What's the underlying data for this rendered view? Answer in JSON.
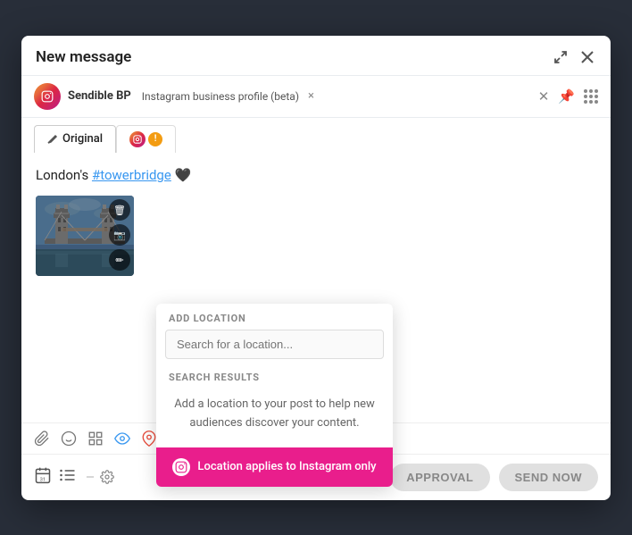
{
  "modal": {
    "title": "New message",
    "expand_icon": "expand",
    "close_icon": "close"
  },
  "profile_bar": {
    "name": "Sendible BP",
    "type": "Instagram business profile (beta)",
    "close_tag": "×",
    "pin_icon": "pin",
    "grid_icon": "grid"
  },
  "tabs": [
    {
      "id": "original",
      "label": "Original",
      "icon": "pencil",
      "active": true
    },
    {
      "id": "instagram",
      "label": "",
      "icon": "instagram",
      "active": false
    }
  ],
  "composer": {
    "message": "London's #towerbridge 🖤",
    "hashtag": "#towerbridge",
    "image_alt": "Tower Bridge London"
  },
  "toolbar": {
    "icons": [
      "paperclip",
      "emoji",
      "grid",
      "eye",
      "location"
    ]
  },
  "footer": {
    "approval_button": "APPROVAL",
    "send_button": "SEND NOW"
  },
  "location_dropdown": {
    "add_location_label": "ADD LOCATION",
    "search_placeholder": "Search for a location...",
    "search_results_label": "SEARCH RESULTS",
    "empty_message_line1": "Add a location to your post to help new",
    "empty_message_line2": "audiences discover your content.",
    "footer_text": "Location applies to Instagram only",
    "footer_icon": "instagram"
  }
}
